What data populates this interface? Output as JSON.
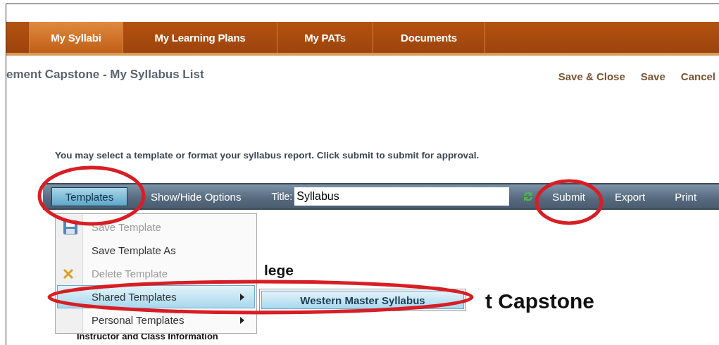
{
  "nav": {
    "tabs": [
      {
        "label": "My Syllabi",
        "selected": true
      },
      {
        "label": "My Learning Plans",
        "selected": false
      },
      {
        "label": "My PATs",
        "selected": false
      },
      {
        "label": "Documents",
        "selected": false
      }
    ]
  },
  "page_title": "ement Capstone - My Syllabus List",
  "actions": [
    "Save & Close",
    "Save",
    "Cancel"
  ],
  "instructions": "You may select a template or format your syllabus report. Click submit to submit for approval.",
  "toolbar": {
    "templates_button": {
      "label": "Templates",
      "expanded": true
    },
    "show_hide": "Show/Hide Options",
    "title_label": "Title:",
    "title_value": "Syllabus",
    "buttons": [
      "Submit",
      "Export",
      "Print"
    ]
  },
  "templates_menu": {
    "items": [
      {
        "label": "Save Template",
        "kind": "save",
        "disabled": true,
        "selected": false
      },
      {
        "label": "Save Template As",
        "kind": "plain",
        "disabled": false,
        "selected": false
      },
      {
        "label": "Delete Template",
        "kind": "delete",
        "disabled": true,
        "selected": false
      },
      {
        "label": "Shared Templates",
        "kind": "submenu",
        "disabled": false,
        "selected": true
      },
      {
        "label": "Personal Templates",
        "kind": "submenu",
        "disabled": false,
        "selected": false
      }
    ]
  },
  "shared_submenu": {
    "items": [
      {
        "label": "Western Master Syllabus",
        "selected": true
      }
    ]
  },
  "document": {
    "college_heading_fragment": "lege",
    "course_heading_fragment": "t Capstone",
    "section_heading": "Instructor and Class Information"
  }
}
